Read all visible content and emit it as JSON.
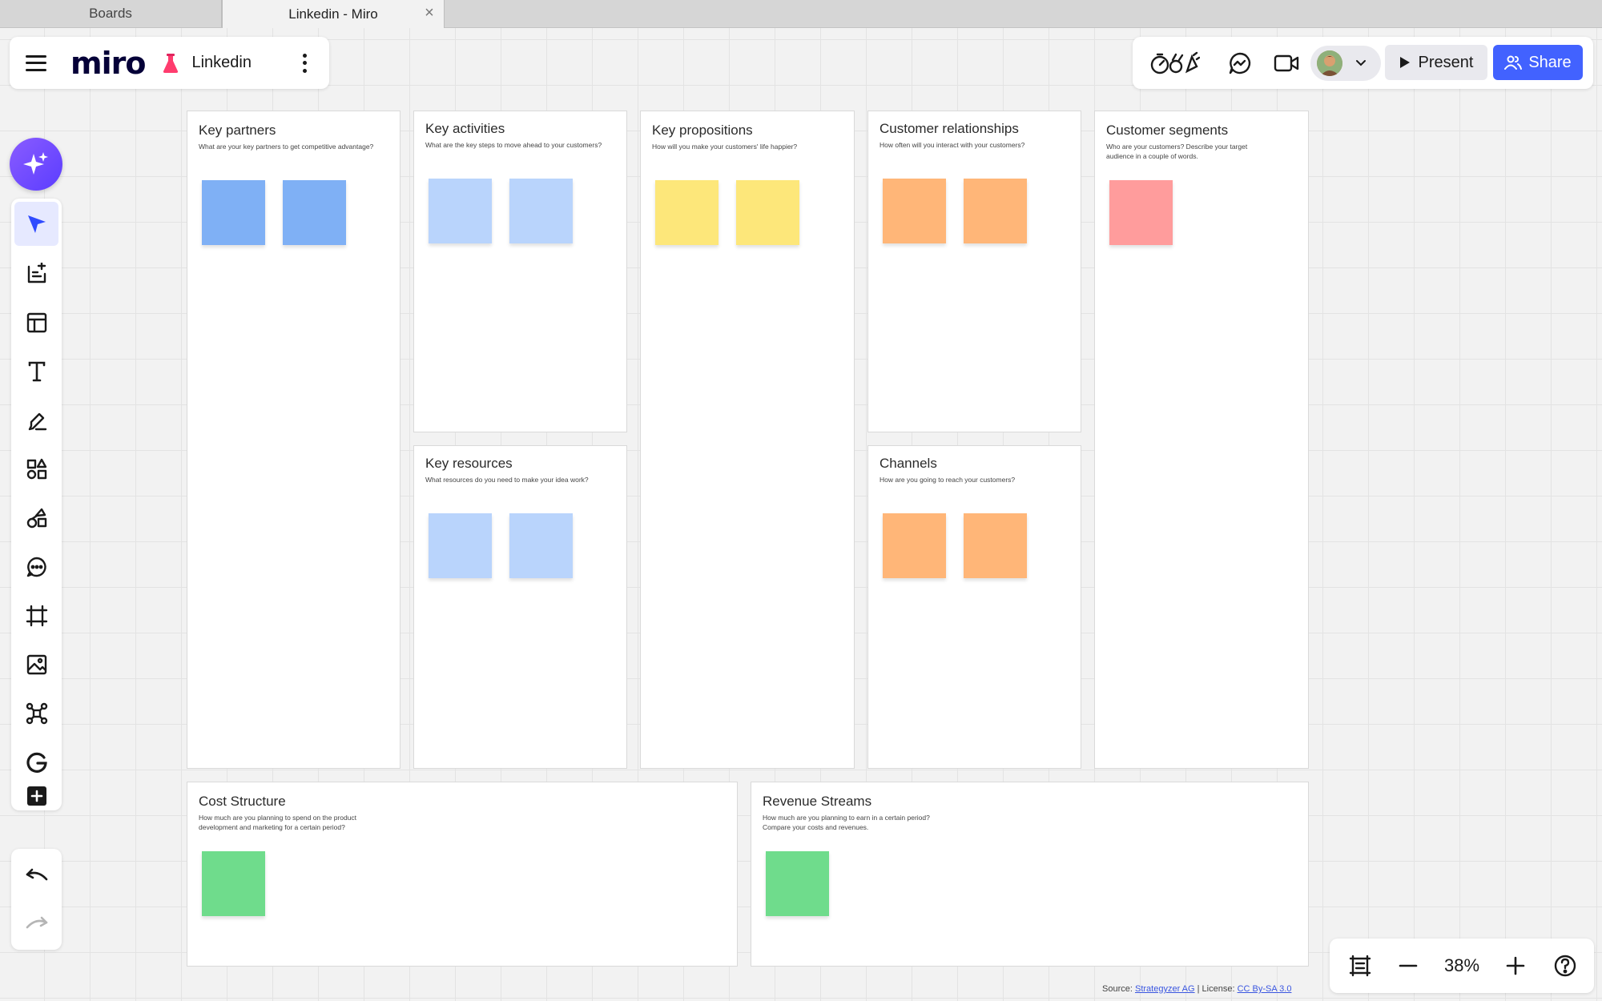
{
  "browser": {
    "tabs": [
      {
        "label": "Boards"
      },
      {
        "label": "Linkedin - Miro"
      }
    ],
    "close_glyph": "×"
  },
  "board_panel": {
    "logo": "miro",
    "board_name": "Linkedin"
  },
  "top_actions": {
    "present_label": "Present",
    "share_label": "Share"
  },
  "zoom": {
    "level": "38%"
  },
  "canvas": {
    "cards": [
      {
        "title": "Key partners",
        "subtitle": "What are your key partners to get competitive advantage?"
      },
      {
        "title": "Key activities",
        "subtitle": "What are the key steps to move ahead to your customers?"
      },
      {
        "title": "Key resources",
        "subtitle": "What resources do you need to make your idea work?"
      },
      {
        "title": "Key propositions",
        "subtitle": "How will you make your customers' life happier?"
      },
      {
        "title": "Customer relationships",
        "subtitle": "How often will you interact with your customers?"
      },
      {
        "title": "Channels",
        "subtitle": "How are you going to reach your customers?"
      },
      {
        "title": "Customer segments",
        "subtitle": "Who are your customers? Describe your target audience in a couple of words."
      },
      {
        "title": "Cost Structure",
        "subtitle": "How much are you planning to spend on the product development and marketing for a certain period?"
      },
      {
        "title": "Revenue Streams",
        "subtitle": "How much are you planning to earn in a certain period? Compare your costs and revenues."
      }
    ],
    "sticky_colors": {
      "blue": "#7fb0f5",
      "light_blue": "#b9d4fc",
      "yellow": "#fde77a",
      "orange": "#ffb678",
      "pink": "#ff9c9c",
      "green": "#6fdc8c"
    }
  },
  "footer": {
    "source_label": "Source:",
    "source_link": "Strategyzer AG",
    "separator": "| License:",
    "license_link": "CC By-SA 3.0"
  },
  "colors": {
    "accent": "#4262ff",
    "toolbar_active": "#e6e9ff"
  }
}
